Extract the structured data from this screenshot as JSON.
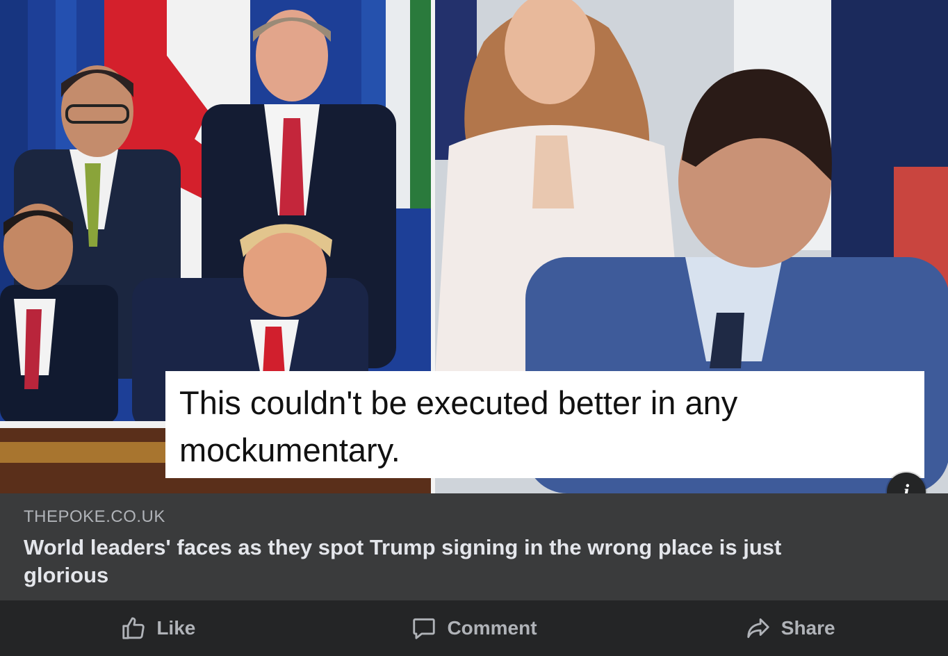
{
  "post": {
    "image": {
      "left_panel_alt": "Leaders at a signing table",
      "right_panel_alt": "Two leaders at a signing table",
      "caption": "This couldn't be executed better in any mockumentary."
    },
    "info_icon": "info-icon",
    "link": {
      "domain": "THEPOKE.CO.UK",
      "title": "World leaders' faces as they spot Trump signing in the wrong place is just glorious"
    },
    "actions": [
      {
        "label": "Like",
        "icon": "thumbs-up-icon"
      },
      {
        "label": "Comment",
        "icon": "comment-icon"
      },
      {
        "label": "Share",
        "icon": "share-icon"
      }
    ]
  },
  "colors": {
    "card_bg": "#242526",
    "meta_bg": "#3a3b3c",
    "primary_text": "#e4e6eb",
    "secondary_text": "#b0b3b8"
  }
}
